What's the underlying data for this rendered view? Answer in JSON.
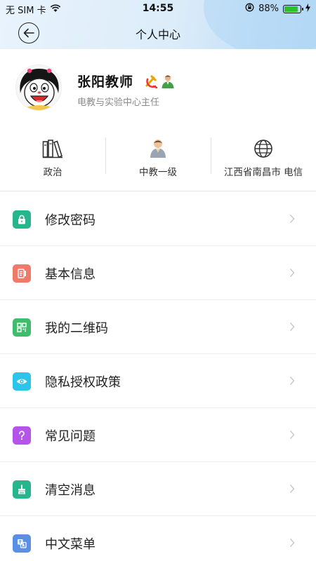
{
  "status_bar": {
    "carrier": "无 SIM 卡",
    "time": "14:55",
    "battery": "88%",
    "battery_level": 0.88
  },
  "nav": {
    "title": "个人中心"
  },
  "profile": {
    "name": "张阳教师",
    "subtitle": "电教与实验中心主任"
  },
  "info": [
    {
      "label": "政治",
      "icon": "books-icon"
    },
    {
      "label": "中教一级",
      "icon": "teacher-icon"
    },
    {
      "label": "江西省南昌市 电信",
      "icon": "globe-icon"
    }
  ],
  "menu": [
    {
      "label": "修改密码",
      "icon": "lock-icon",
      "color": "#27b58e"
    },
    {
      "label": "基本信息",
      "icon": "info-card-icon",
      "color": "#f07a6a"
    },
    {
      "label": "我的二维码",
      "icon": "qrcode-icon",
      "color": "#3fbd6c"
    },
    {
      "label": "隐私授权政策",
      "icon": "eye-icon",
      "color": "#2cc4e8"
    },
    {
      "label": "常见问题",
      "icon": "question-icon",
      "color": "#b454e8"
    },
    {
      "label": "清空消息",
      "icon": "broom-icon",
      "color": "#27b58e"
    },
    {
      "label": "中文菜单",
      "icon": "language-icon",
      "color": "#5b8fe6"
    }
  ]
}
